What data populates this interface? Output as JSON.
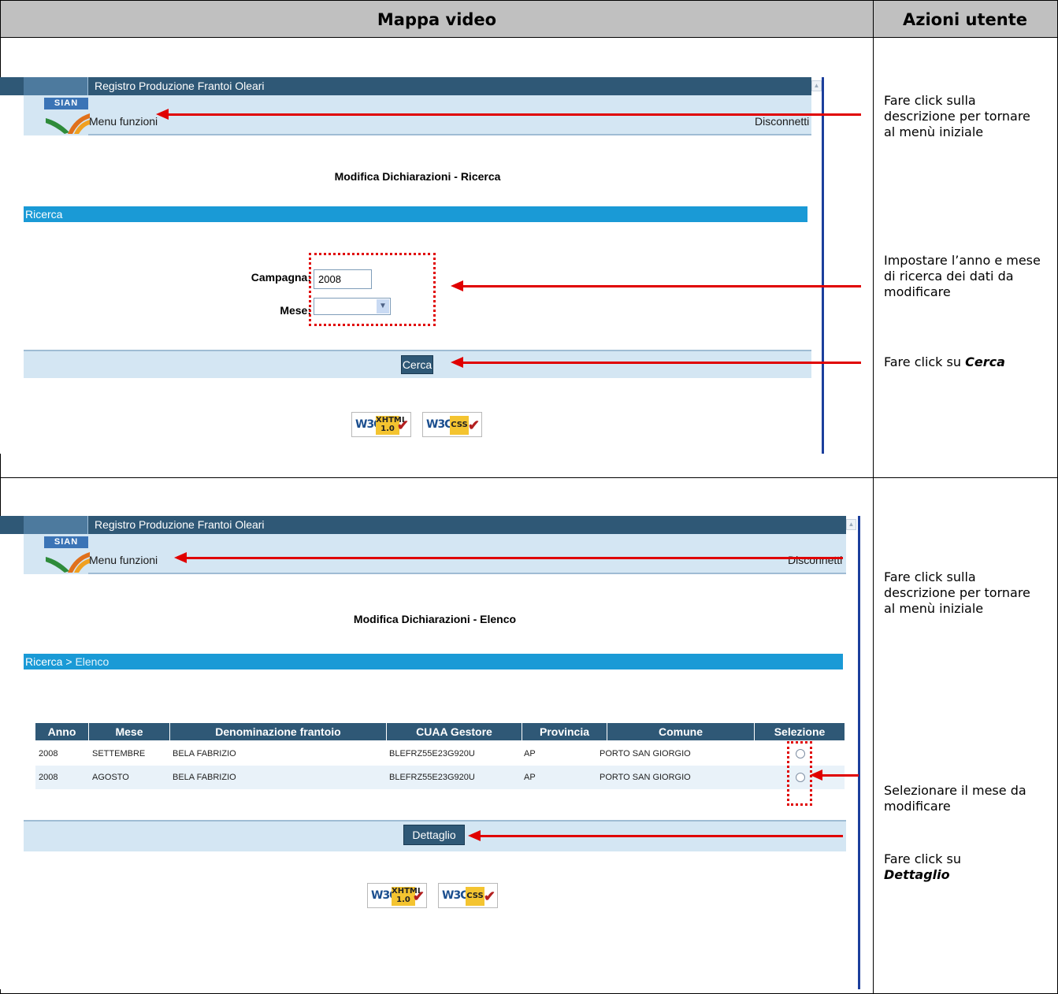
{
  "header": {
    "left": "Mappa video",
    "right": "Azioni utente"
  },
  "app": {
    "title": "Registro Produzione Frantoi Oleari",
    "logo_text": "SIAN",
    "menu_link": "Menu funzioni",
    "logout_link": "Disconnetti"
  },
  "badges": {
    "w3c": "W3C",
    "xhtml": "XHTML",
    "xhtml_ver": "1.0",
    "css": "CSS"
  },
  "screen1": {
    "page_title": "Modifica Dichiarazioni - Ricerca",
    "section": "Ricerca",
    "campagna_label": "Campagna:",
    "campagna_value": "2008",
    "mese_label": "Mese:",
    "mese_value": "",
    "search_button": "Cerca"
  },
  "screen2": {
    "page_title": "Modifica Dichiarazioni - Elenco",
    "breadcrumb_root": "Ricerca",
    "breadcrumb_sep": " > ",
    "breadcrumb_current": "Elenco",
    "columns": [
      "Anno",
      "Mese",
      "Denominazione frantoio",
      "CUAA Gestore",
      "Provincia",
      "Comune",
      "Selezione"
    ],
    "rows": [
      [
        "2008",
        "SETTEMBRE",
        "BELA FABRIZIO",
        "BLEFRZ55E23G920U",
        "AP",
        "PORTO SAN GIORGIO"
      ],
      [
        "2008",
        "AGOSTO",
        "BELA FABRIZIO",
        "BLEFRZ55E23G920U",
        "AP",
        "PORTO SAN GIORGIO"
      ]
    ],
    "detail_button": "Dettaglio"
  },
  "notes": {
    "n1": "Fare click sulla descrizione per tornare al menù iniziale",
    "n2": "Impostare l’anno e mese di ricerca dei dati da modificare",
    "n3_prefix": "Fare click su ",
    "n3_bold": "Cerca",
    "n4": "Fare click sulla descrizione per tornare al menù iniziale",
    "n5": "Selezionare il mese da modificare",
    "n6_prefix": "Fare click su",
    "n6_bold": "Dettaglio"
  },
  "colors": {
    "title_bar": "#2f5876",
    "menu_bar": "#d4e6f3",
    "section_bar": "#1a9ad6",
    "annotation": "#e00000"
  }
}
